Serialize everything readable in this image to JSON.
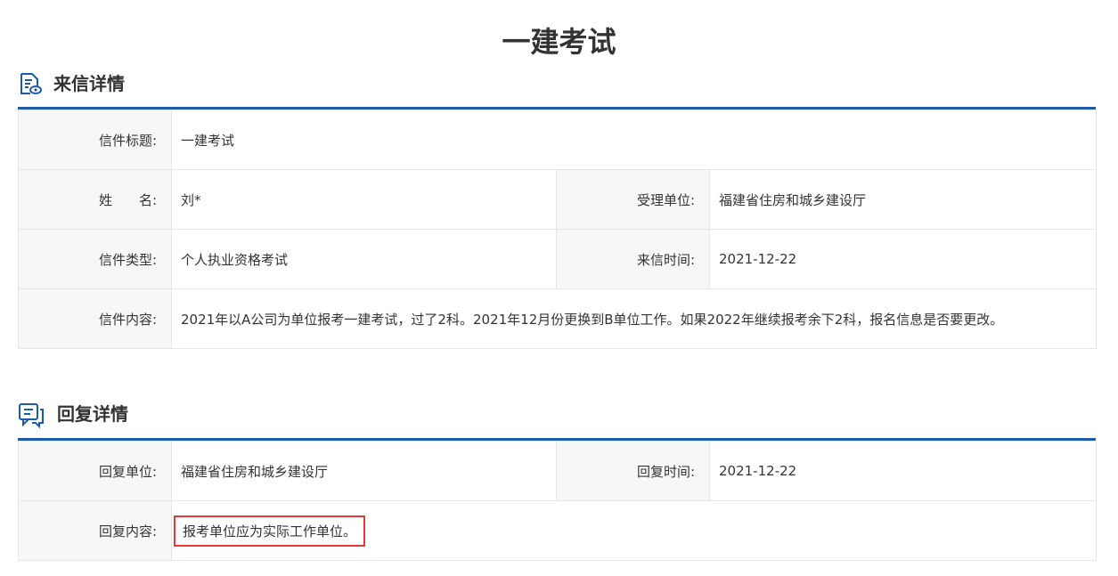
{
  "page": {
    "title": "一建考试"
  },
  "letter": {
    "section_title": "来信详情",
    "rows": {
      "title_label": "信件标题:",
      "title_value": "一建考试",
      "name_label": "姓　　名:",
      "name_value": "刘*",
      "dept_label": "受理单位:",
      "dept_value": "福建省住房和城乡建设厅",
      "type_label": "信件类型:",
      "type_value": "个人执业资格考试",
      "time_label": "来信时间:",
      "time_value": "2021-12-22",
      "content_label": "信件内容:",
      "content_value": "2021年以A公司为单位报考一建考试，过了2科。2021年12月份更换到B单位工作。如果2022年继续报考余下2科，报名信息是否要更改。"
    }
  },
  "reply": {
    "section_title": "回复详情",
    "rows": {
      "unit_label": "回复单位:",
      "unit_value": "福建省住房和城乡建设厅",
      "time_label": "回复时间:",
      "time_value": "2021-12-22",
      "content_label": "回复内容:",
      "content_value": "报考单位应为实际工作单位。"
    }
  },
  "colors": {
    "accent": "#1d5ba8",
    "highlight": "#e53935",
    "label_bg": "#f7f7f7",
    "border": "#e6e6e6"
  },
  "icons": {
    "letter_section": "document-view-icon",
    "reply_section": "chat-bubble-icon"
  }
}
